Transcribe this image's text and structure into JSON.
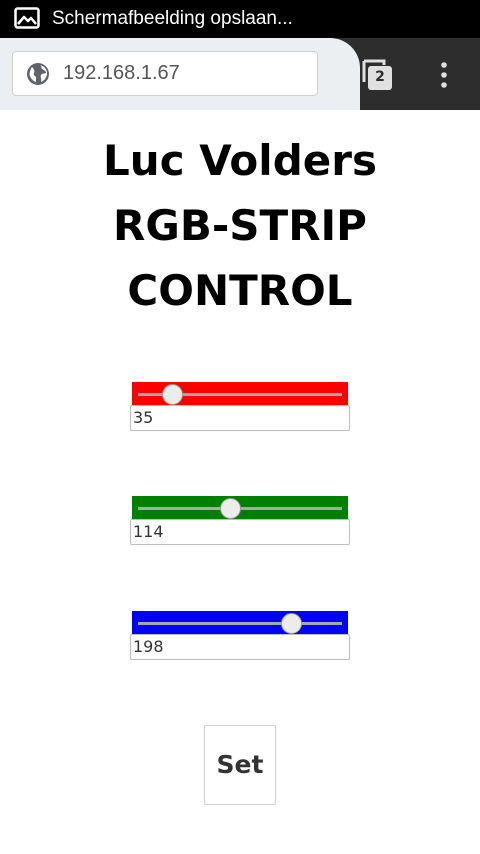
{
  "status_bar": {
    "text": "Schermafbeelding opslaan...",
    "icon": "image-icon"
  },
  "browser": {
    "url": "192.168.1.67",
    "site_icon": "globe-icon",
    "tab_count": "2",
    "menu_icon": "more-vert-icon"
  },
  "page": {
    "title_lines": [
      "Luc Volders",
      "RGB-STRIP",
      "CONTROL"
    ],
    "sliders": [
      {
        "name": "red",
        "color": "#ff0000",
        "value": "35",
        "min": 0,
        "max": 255
      },
      {
        "name": "green",
        "color": "#008000",
        "value": "114",
        "min": 0,
        "max": 255
      },
      {
        "name": "blue",
        "color": "#0000ff",
        "value": "198",
        "min": 0,
        "max": 255
      }
    ],
    "set_label": "Set"
  }
}
